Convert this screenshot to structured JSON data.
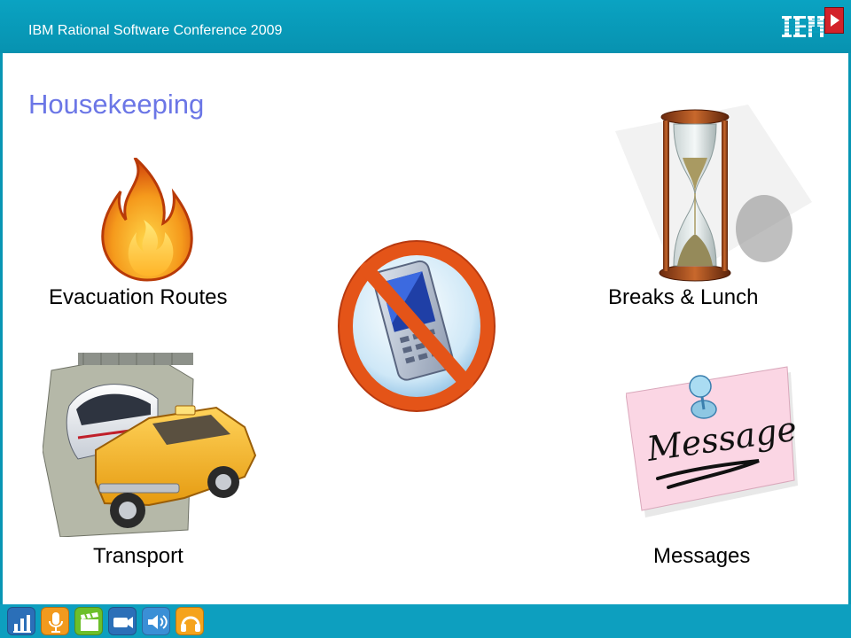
{
  "header": {
    "conference": "IBM Rational Software Conference 2009",
    "logo_text": "IBM"
  },
  "page": {
    "title": "Housekeeping"
  },
  "items": {
    "evacuation": "Evacuation Routes",
    "breaks": "Breaks & Lunch",
    "transport": "Transport",
    "messages": "Messages"
  },
  "clipart": {
    "message_note": "Message"
  },
  "icons": {
    "footer": [
      "stats-icon",
      "microphone-icon",
      "clapperboard-icon",
      "video-camera-icon",
      "speaker-icon",
      "headphones-icon"
    ],
    "center": "no-phone-icon"
  },
  "colors": {
    "accent": "#0aa3c2",
    "title": "#6b76e6",
    "footer": "#0d9fbf"
  }
}
